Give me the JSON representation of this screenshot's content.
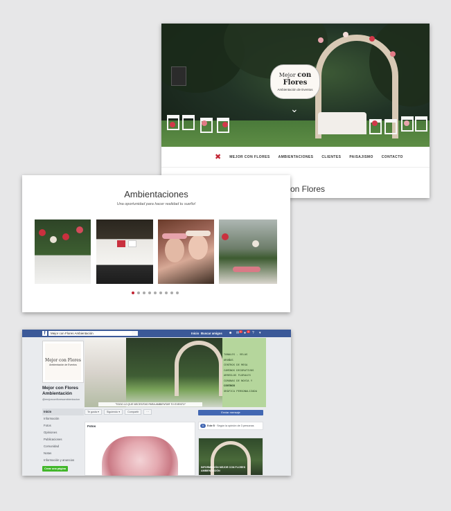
{
  "website": {
    "logo": {
      "line1a": "Mejor ",
      "line1b": "con Flores",
      "line2": "Ambientación de Eventos"
    },
    "nav": [
      "MEJOR CON FLORES",
      "AMBIENTACIONES",
      "CLIENTES",
      "PAISAJISMO",
      "CONTACTO"
    ],
    "heading_fragment": "on Flores"
  },
  "ambientaciones": {
    "title": "Ambientaciones",
    "subtitle": "Una oportunidad para hacer realidad tu sueño!",
    "slides_total": 9,
    "active_slide": 1
  },
  "facebook": {
    "search_value": "Mejor con Flores Ambientación",
    "top_links": [
      "Inicio",
      "Buscar amigos"
    ],
    "notification_badges": [
      "1",
      "1"
    ],
    "avatar_logo": {
      "line1": "Mejor con Flores",
      "line2": "Ambientación de Eventos"
    },
    "page_name": "Mejor con Flores Ambientación",
    "handle": "@mejorconfloresambientacion",
    "menu": [
      "Inicio",
      "Información",
      "Fotos",
      "Opiniones",
      "Publicaciones",
      "Comunidad",
      "Notas",
      "Información y anuncios"
    ],
    "create_page": "Crear una página",
    "cover_list": [
      "TANALES - VELAS",
      "ARAÑAS",
      "CENTROS DE MESA",
      "CAMINOS DECORATIVOS",
      "ARREGLOS FLORALES",
      "CORONAS DE NOVIA Y CORTEJO",
      "LIVINGS",
      "GRÁFICA PERSONALIZADA"
    ],
    "cover_quote": "\"TODO LO QUE NECESITAS PARA AMBIENTAR TU EVENTO\"",
    "actions": [
      "Te gusta ▾",
      "Siguiendo ▾",
      "Compartir",
      "···"
    ],
    "send_message": "Enviar mensaje",
    "photos_header": "Fotos",
    "rating_score": "5",
    "rating_text_bold": "5 de 5",
    "rating_text": " · Según la opinión de 3 personas",
    "album_caption": "INFORMACIÓN MEJOR CON FLORES AMBIENTACIÓN"
  },
  "colors": {
    "brand_red": "#c22433",
    "facebook_blue": "#3b5998",
    "facebook_button": "#4267b2",
    "create_green": "#42b72a",
    "cover_panel_green": "#b5d69c",
    "background": "#e7e7e8"
  },
  "icons": [
    "facebook-f-icon",
    "search-icon",
    "friends-icon",
    "messages-icon",
    "notifications-icon",
    "help-icon",
    "chevron-down-icon",
    "x-logo-icon"
  ]
}
